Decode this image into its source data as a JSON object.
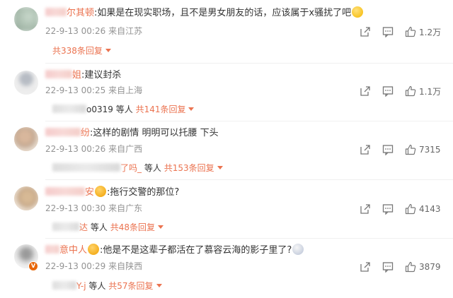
{
  "comments": [
    {
      "name_suffix": "尔其顿",
      "text": ":如果是在现实职场，且不是男女朋友的话，应该属于x骚扰了吧",
      "date": "22-9-13 00:26",
      "location": "来自江苏",
      "likes": "1.2万",
      "replies_label": "共338条回复",
      "reply_users": "",
      "reply_users_suffix": ""
    },
    {
      "name_suffix": "姐",
      "text": ":建议封杀",
      "date": "22-9-13 00:25",
      "location": "来自上海",
      "likes": "1.1万",
      "replies_label": "共141条回复",
      "reply_users": "o0319",
      "reply_users_suffix": "等人"
    },
    {
      "name_suffix": "纷",
      "text": ":这样的剧情 明明可以托腰 下头",
      "date": "22-9-13 00:26",
      "location": "来自广西",
      "likes": "7315",
      "replies_label": "共153条回复",
      "reply_users": "了吗_",
      "reply_users_suffix": "等人"
    },
    {
      "name_suffix": "安",
      "text": ":拖行交警的那位?",
      "date": "22-9-13 00:30",
      "location": "来自广东",
      "likes": "4143",
      "replies_label": "共48条回复",
      "reply_users": "达",
      "reply_users_suffix": "等人"
    },
    {
      "name_suffix": "意中人",
      "text": ":他是不是这辈子都活在了慕容云海的影子里了?",
      "date": "22-9-13 00:29",
      "location": "来自陕西",
      "likes": "3879",
      "replies_label": "共57条回复",
      "reply_users": "Y-j",
      "reply_users_suffix": "等人"
    }
  ],
  "icons": [
    "share-icon",
    "comment-icon",
    "like-icon",
    "chevron-down-icon"
  ],
  "colors": {
    "accent": "#eb7350",
    "meta": "#939393",
    "text": "#333333"
  }
}
